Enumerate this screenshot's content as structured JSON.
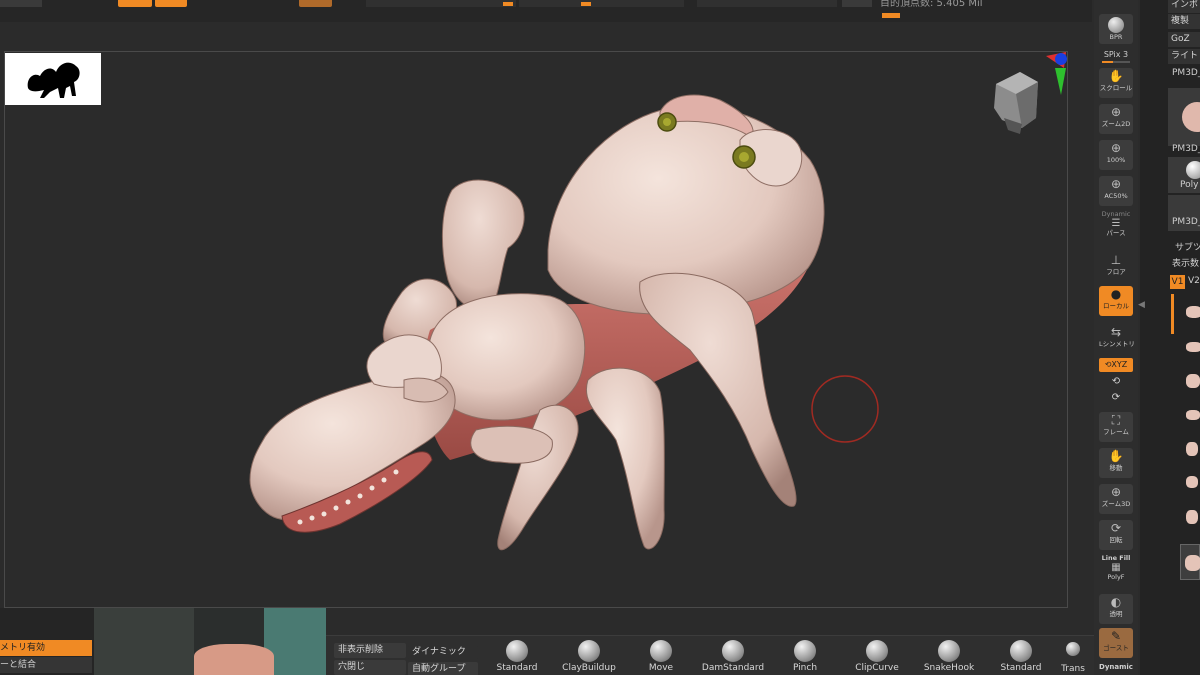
{
  "app": "ZBrush",
  "top_bar": {
    "stat_text": "目的頂点数: 5.405 Mil"
  },
  "shelf": {
    "bpr_label": "BPR",
    "spix_label": "SPix 3",
    "buttons": [
      {
        "id": "scroll",
        "label": "スクロール",
        "icon": "scroll-icon"
      },
      {
        "id": "zoom2d",
        "label": "ズーム2D",
        "icon": "zoom2d-icon"
      },
      {
        "id": "100",
        "label": "100%",
        "icon": "actual-size-icon"
      },
      {
        "id": "ac50",
        "label": "AC50%",
        "icon": "half-size-icon"
      },
      {
        "id": "perspective",
        "label": "パース",
        "top_label": "Dynamic",
        "icon": "perspective-icon"
      },
      {
        "id": "floor",
        "label": "フロア",
        "icon": "floor-icon"
      },
      {
        "id": "local",
        "label": "ローカル",
        "icon": "local-icon",
        "active": true
      },
      {
        "id": "lsym",
        "label": "Lシンメトリ",
        "icon": "symmetry-icon"
      },
      {
        "id": "frame",
        "label": "フレーム",
        "icon": "frame-icon"
      },
      {
        "id": "move",
        "label": "移動",
        "icon": "move-hand-icon"
      },
      {
        "id": "zoom3d",
        "label": "ズーム3D",
        "icon": "zoom3d-icon"
      },
      {
        "id": "rotate",
        "label": "回転",
        "icon": "rotate-icon"
      },
      {
        "id": "polyf",
        "label": "PolyF",
        "top_label": "Line Fill",
        "icon": "polyframe-icon"
      },
      {
        "id": "transp",
        "label": "透明",
        "icon": "transparency-icon"
      },
      {
        "id": "ghost",
        "label": "ゴースト",
        "icon": "ghost-icon",
        "active": true
      }
    ],
    "xyz_label": "XYZ",
    "dynamic_bottom": "Dynamic"
  },
  "tray": {
    "buttons": [
      "インポ",
      "複製",
      "GoZ",
      "ライト"
    ],
    "tool_label_1": "PM3D_",
    "tool_label_2": "PM3D_",
    "tool_label_3": "Poly",
    "tool_label_4": "PM3D_",
    "subtool_header": "サブツ",
    "display_count": "表示数",
    "v1": "V1",
    "v2": "V2"
  },
  "bottom": {
    "geometry_btn": "メトリ有効",
    "merge_btn": "ーと結合",
    "hide_delete": "非表示削除",
    "close_holes": "穴閉じ",
    "dynamic": "ダイナミック",
    "auto_group": "自動グループ",
    "brushes": [
      {
        "name": "Standard"
      },
      {
        "name": "ClayBuildup"
      },
      {
        "name": "Move"
      },
      {
        "name": "DamStandard"
      },
      {
        "name": "Pinch"
      },
      {
        "name": "ClipCurve"
      },
      {
        "name": "SnakeHook"
      },
      {
        "name": "Standard"
      },
      {
        "name": "Trans"
      }
    ]
  },
  "colors": {
    "accent": "#f08a24",
    "background": "#2b2b2b",
    "model_skin": "#e8d2c8",
    "model_inner": "#c46a62"
  }
}
